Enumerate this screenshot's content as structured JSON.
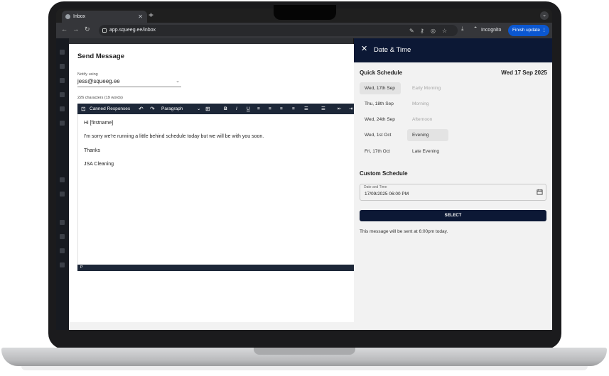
{
  "browser": {
    "tab_title": "Inbox",
    "tab_close": "✕",
    "new_tab": "+",
    "url": "app.squeeg.ee/inbox",
    "incognito_label": "Incognito",
    "finish_update_label": "Finish update"
  },
  "dialog": {
    "title": "Send Message",
    "notify_label": "Notify using",
    "notify_value": "jess@squeeg.ee",
    "char_count": "226 characters (19 words)",
    "toolbar": {
      "canned_responses": "Canned Responses",
      "block_format": "Paragraph"
    },
    "body_lines": [
      "Hi [firstname]",
      "I'm sorry we're running a little behind schedule today but we will be with you soon.",
      "Thanks",
      "JSA Cleaning"
    ],
    "status_path": "P"
  },
  "panel": {
    "close_icon": "✕",
    "title": "Date & Time",
    "quick_schedule_title": "Quick Schedule",
    "selected_date": "Wed 17 Sep 2025",
    "quick_dates": [
      {
        "label": "Wed, 17th Sep",
        "selected": true
      },
      {
        "label": "Thu, 18th Sep",
        "selected": false
      },
      {
        "label": "Wed, 24th Sep",
        "selected": false
      },
      {
        "label": "Wed, 1st Oct",
        "selected": false
      },
      {
        "label": "Fri, 17th Oct",
        "selected": false
      }
    ],
    "quick_times": [
      {
        "label": "Early Morning",
        "state": "disabled"
      },
      {
        "label": "Morning",
        "state": "disabled"
      },
      {
        "label": "Afternoon",
        "state": "disabled"
      },
      {
        "label": "Evening",
        "state": "selected"
      },
      {
        "label": "Late Evening",
        "state": "enabled"
      }
    ],
    "custom_schedule_title": "Custom Schedule",
    "datetime_label": "Date and Time",
    "datetime_value": "17/09/2025 06:00 PM",
    "select_button": "SELECT",
    "sent_message": "This message will be sent at 6:00pm today."
  },
  "colors": {
    "navy": "#0c1835",
    "editor_toolbar": "#1d2738",
    "chrome_update": "#0b57d0"
  }
}
